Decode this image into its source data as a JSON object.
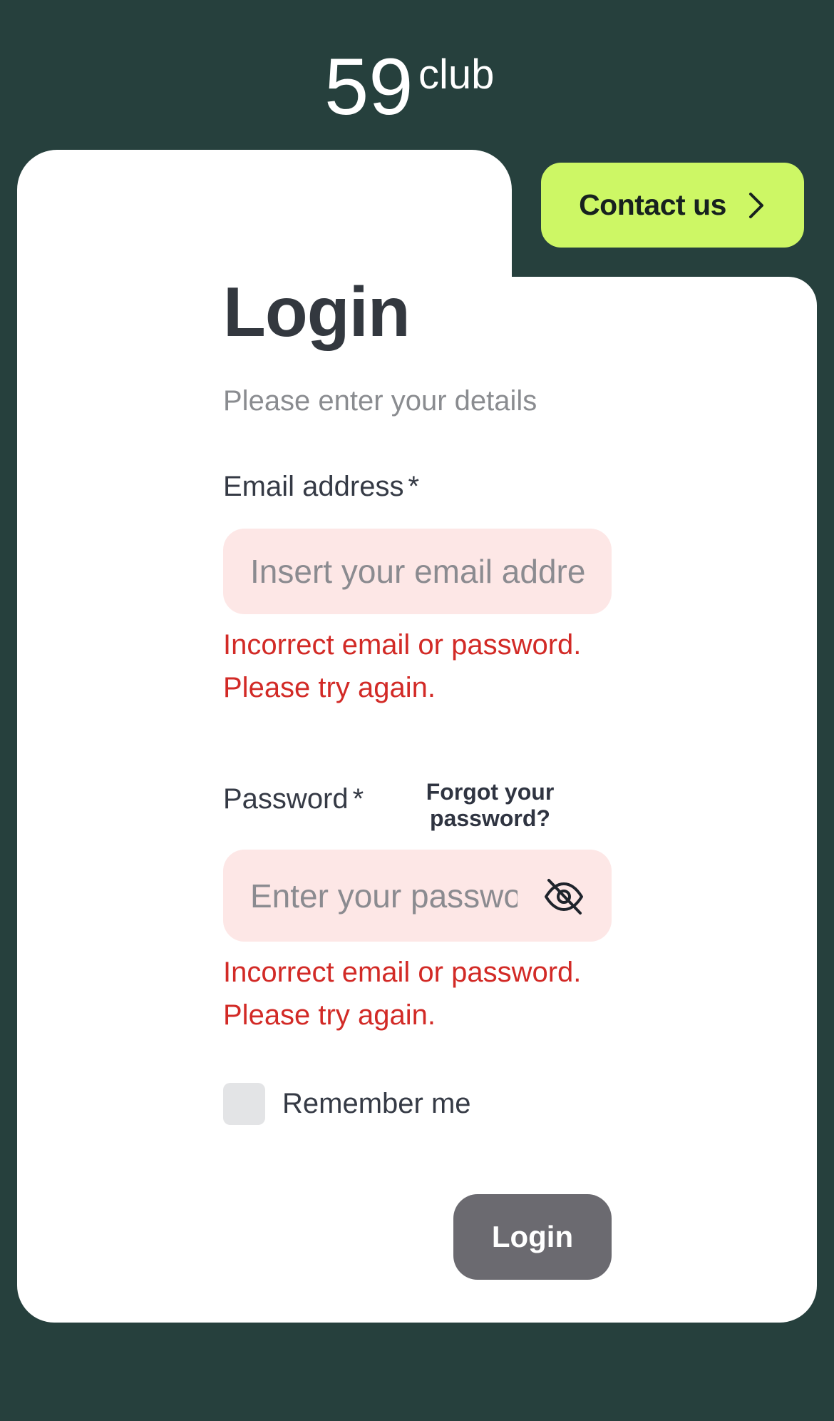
{
  "logo": {
    "brand_text": "59club",
    "number": "59",
    "word": "club"
  },
  "header": {
    "contact_label": "Contact us"
  },
  "login": {
    "title": "Login",
    "subtitle": "Please enter your details"
  },
  "email": {
    "label": "Email address",
    "required_mark": "*",
    "placeholder": "Insert your email address",
    "error_line1": "Incorrect email or password.",
    "error_line2": "Please try again."
  },
  "password": {
    "label": "Password",
    "required_mark": "*",
    "placeholder": "Enter your password",
    "forgot_line1": "Forgot your",
    "forgot_line2": "password?",
    "error_line1": "Incorrect email or password.",
    "error_line2": "Please try again."
  },
  "remember": {
    "label": "Remember me",
    "checked": false
  },
  "submit": {
    "label": "Login"
  },
  "icons": {
    "contact_chevron": "chevron-right-icon",
    "password_toggle": "eye-off-icon"
  },
  "colors": {
    "background": "#26403d",
    "accent": "#cdf765",
    "error": "#d22a26",
    "input_error_bg": "#fde7e6",
    "button_disabled": "#6b6a70"
  }
}
